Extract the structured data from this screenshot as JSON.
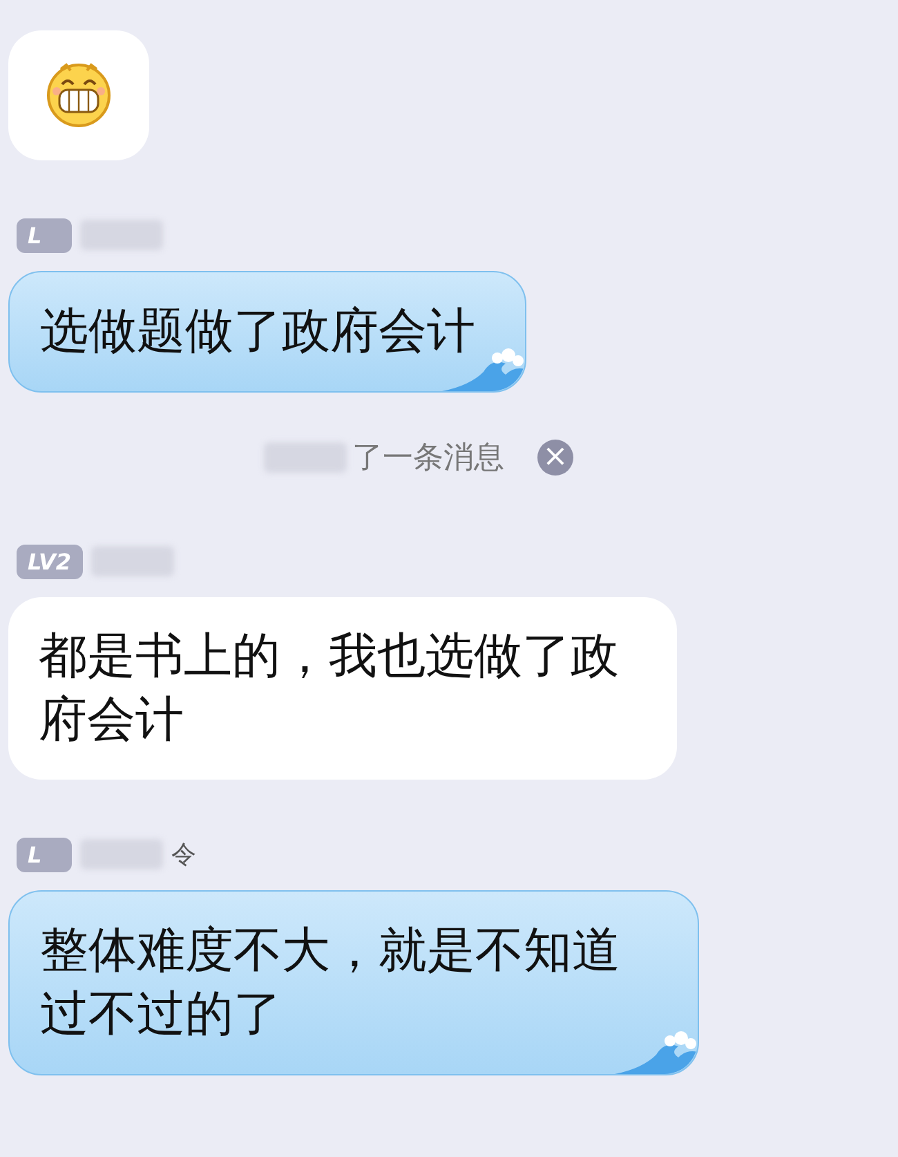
{
  "messages": [
    {
      "kind": "emoji"
    },
    {
      "kind": "wave",
      "badge": "L",
      "text": "选做题做了政府会计"
    },
    {
      "kind": "recall",
      "text": "了一条消息",
      "close": "×"
    },
    {
      "kind": "plain",
      "badge": "LV2",
      "text": "都是书上的，我也选做了政府会计"
    },
    {
      "kind": "wave",
      "badge": "L",
      "name": "令",
      "text": "整体难度不大，就是不知道过不过的了"
    }
  ]
}
